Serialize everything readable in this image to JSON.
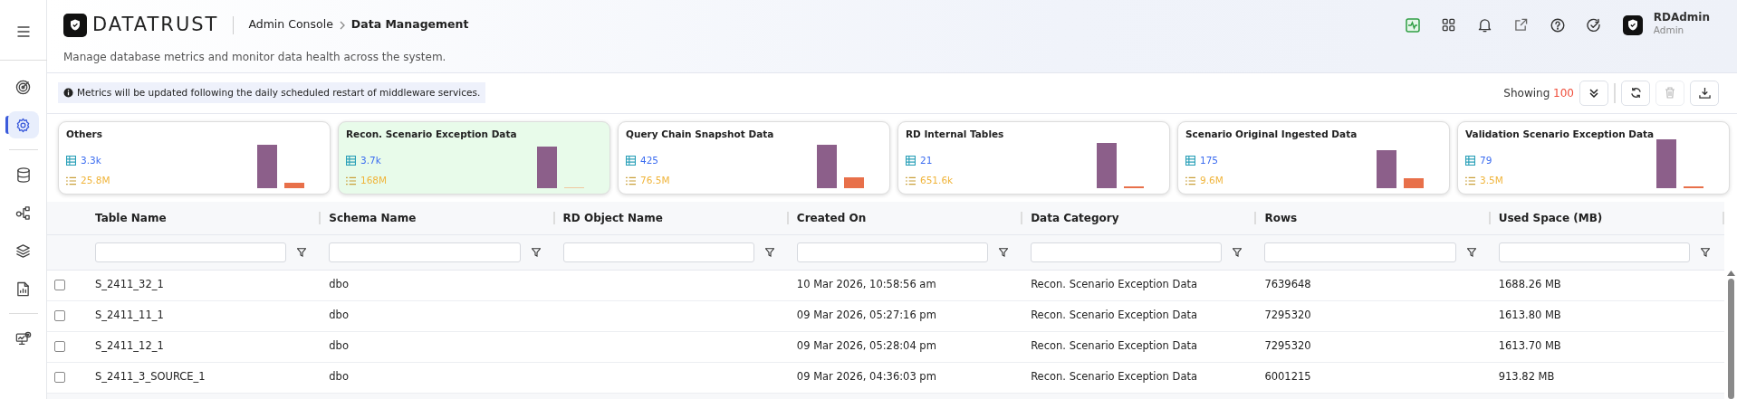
{
  "sidebar": {
    "items": [
      {
        "kind": "target",
        "selected": false
      },
      {
        "kind": "settings",
        "selected": true
      },
      {
        "kind": "database",
        "selected": false
      },
      {
        "kind": "flow",
        "selected": false
      },
      {
        "kind": "layers",
        "selected": false
      },
      {
        "kind": "report",
        "selected": false
      },
      {
        "kind": "monitor",
        "selected": false
      }
    ]
  },
  "header": {
    "logo_text": "DATATRUST",
    "breadcrumb": [
      "Admin Console",
      "Data Management"
    ],
    "subtitle": "Manage database metrics and monitor data health across the system.",
    "user": {
      "name": "RDAdmin",
      "role": "Admin"
    }
  },
  "notice": "Metrics will be updated following the daily scheduled restart of middleware services.",
  "showing": {
    "label": "Showing",
    "count": "100"
  },
  "cards": [
    {
      "title": "Others",
      "tables": "3.3k",
      "rows": "25.8M",
      "selected": false
    },
    {
      "title": "Recon. Scenario Exception Data",
      "tables": "3.7k",
      "rows": "168M",
      "selected": true
    },
    {
      "title": "Query Chain Snapshot Data",
      "tables": "425",
      "rows": "76.5M",
      "selected": false
    },
    {
      "title": "RD Internal Tables",
      "tables": "21",
      "rows": "651.6k",
      "selected": false
    },
    {
      "title": "Scenario Original Ingested Data",
      "tables": "175",
      "rows": "9.6M",
      "selected": false
    },
    {
      "title": "Validation Scenario Exception Data",
      "tables": "79",
      "rows": "3.5M",
      "selected": false
    }
  ],
  "table": {
    "columns": [
      "Table Name",
      "Schema Name",
      "RD Object Name",
      "Created On",
      "Data Category",
      "Rows",
      "Used Space (MB)"
    ],
    "rows": [
      {
        "checked": false,
        "cells": [
          "S_2411_32_1",
          "dbo",
          "",
          "10 Mar 2026, 10:58:56 am",
          "Recon. Scenario Exception Data",
          "7639648",
          "1688.26 MB"
        ]
      },
      {
        "checked": false,
        "cells": [
          "S_2411_11_1",
          "dbo",
          "",
          "09 Mar 2026, 05:27:16 pm",
          "Recon. Scenario Exception Data",
          "7295320",
          "1613.80 MB"
        ]
      },
      {
        "checked": false,
        "cells": [
          "S_2411_12_1",
          "dbo",
          "",
          "09 Mar 2026, 05:28:04 pm",
          "Recon. Scenario Exception Data",
          "7295320",
          "1613.70 MB"
        ]
      },
      {
        "checked": false,
        "cells": [
          "S_2411_3_SOURCE_1",
          "dbo",
          "",
          "09 Mar 2026, 04:36:03 pm",
          "Recon. Scenario Exception Data",
          "6001215",
          "913.82 MB"
        ]
      }
    ]
  }
}
